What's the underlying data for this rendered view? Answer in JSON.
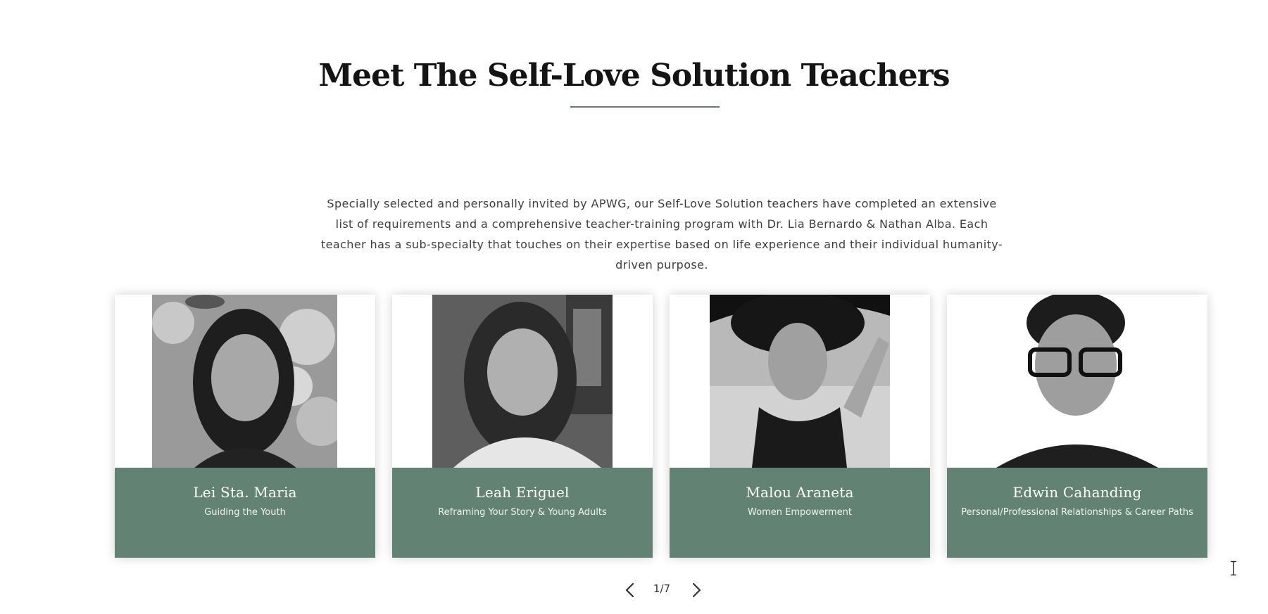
{
  "section": {
    "title": "Meet The Self-Love Solution Teachers",
    "intro": "Specially selected and personally invited by APWG, our Self-Love Solution teachers have completed an extensive list of requirements and a comprehensive teacher-training program with Dr. Lia Bernardo & Nathan Alba. Each teacher has a sub-specialty that touches on their expertise based on life experience and their individual humanity-driven purpose."
  },
  "teachers": [
    {
      "name": "Lei Sta. Maria",
      "specialty": "Guiding the Youth"
    },
    {
      "name": "Leah Eriguel",
      "specialty": "Reframing Your Story & Young Adults"
    },
    {
      "name": "Malou Araneta",
      "specialty": "Women Empowerment"
    },
    {
      "name": "Edwin Cahanding",
      "specialty": "Personal/Professional Relationships & Career Paths"
    }
  ],
  "pagination": {
    "current": "1/7",
    "prev_icon": "chevron-left-icon",
    "next_icon": "chevron-right-icon"
  },
  "colors": {
    "accent": "#628373",
    "underline": "#5c7f72",
    "title": "#141414",
    "body_text": "#3d3d3d"
  }
}
